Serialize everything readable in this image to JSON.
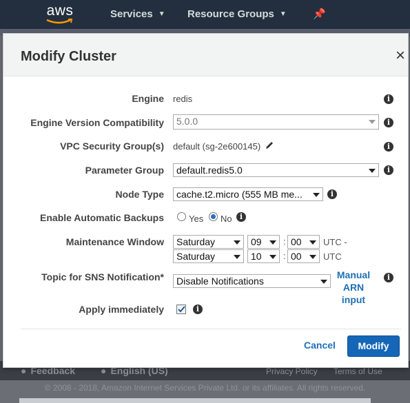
{
  "nav": {
    "logo": "aws",
    "services": "Services",
    "resource_groups": "Resource Groups"
  },
  "footer": {
    "feedback": "Feedback",
    "language": "English (US)",
    "privacy": "Privacy Policy",
    "terms": "Terms of Use",
    "copyright": "© 2008 - 2018, Amazon Internet Services Private Ltd. or its affiliates. All rights reserved."
  },
  "dialog": {
    "title": "Modify Cluster",
    "close": "×",
    "engine": {
      "label": "Engine",
      "value": "redis"
    },
    "engine_version": {
      "label": "Engine Version Compatibility",
      "value": "5.0.0"
    },
    "vpc": {
      "label": "VPC Security Group(s)",
      "value": "default (sg-2e600145)"
    },
    "parameter_group": {
      "label": "Parameter Group",
      "value": "default.redis5.0"
    },
    "node_type": {
      "label": "Node Type",
      "value": "cache.t2.micro (555 MB me..."
    },
    "backups": {
      "label": "Enable Automatic Backups",
      "yes": "Yes",
      "no": "No",
      "selected": "No"
    },
    "maintenance": {
      "label": "Maintenance Window",
      "start": {
        "day": "Saturday",
        "hour": "09",
        "minute": "00",
        "suffix": "UTC -"
      },
      "end": {
        "day": "Saturday",
        "hour": "10",
        "minute": "00",
        "suffix": "UTC"
      },
      "separator": ":"
    },
    "sns": {
      "label": "Topic for SNS Notification*",
      "value": "Disable Notifications",
      "link_line1": "Manual",
      "link_line2": "ARN input"
    },
    "apply": {
      "label": "Apply immediately",
      "checked": true
    },
    "cancel": "Cancel",
    "modify": "Modify"
  }
}
